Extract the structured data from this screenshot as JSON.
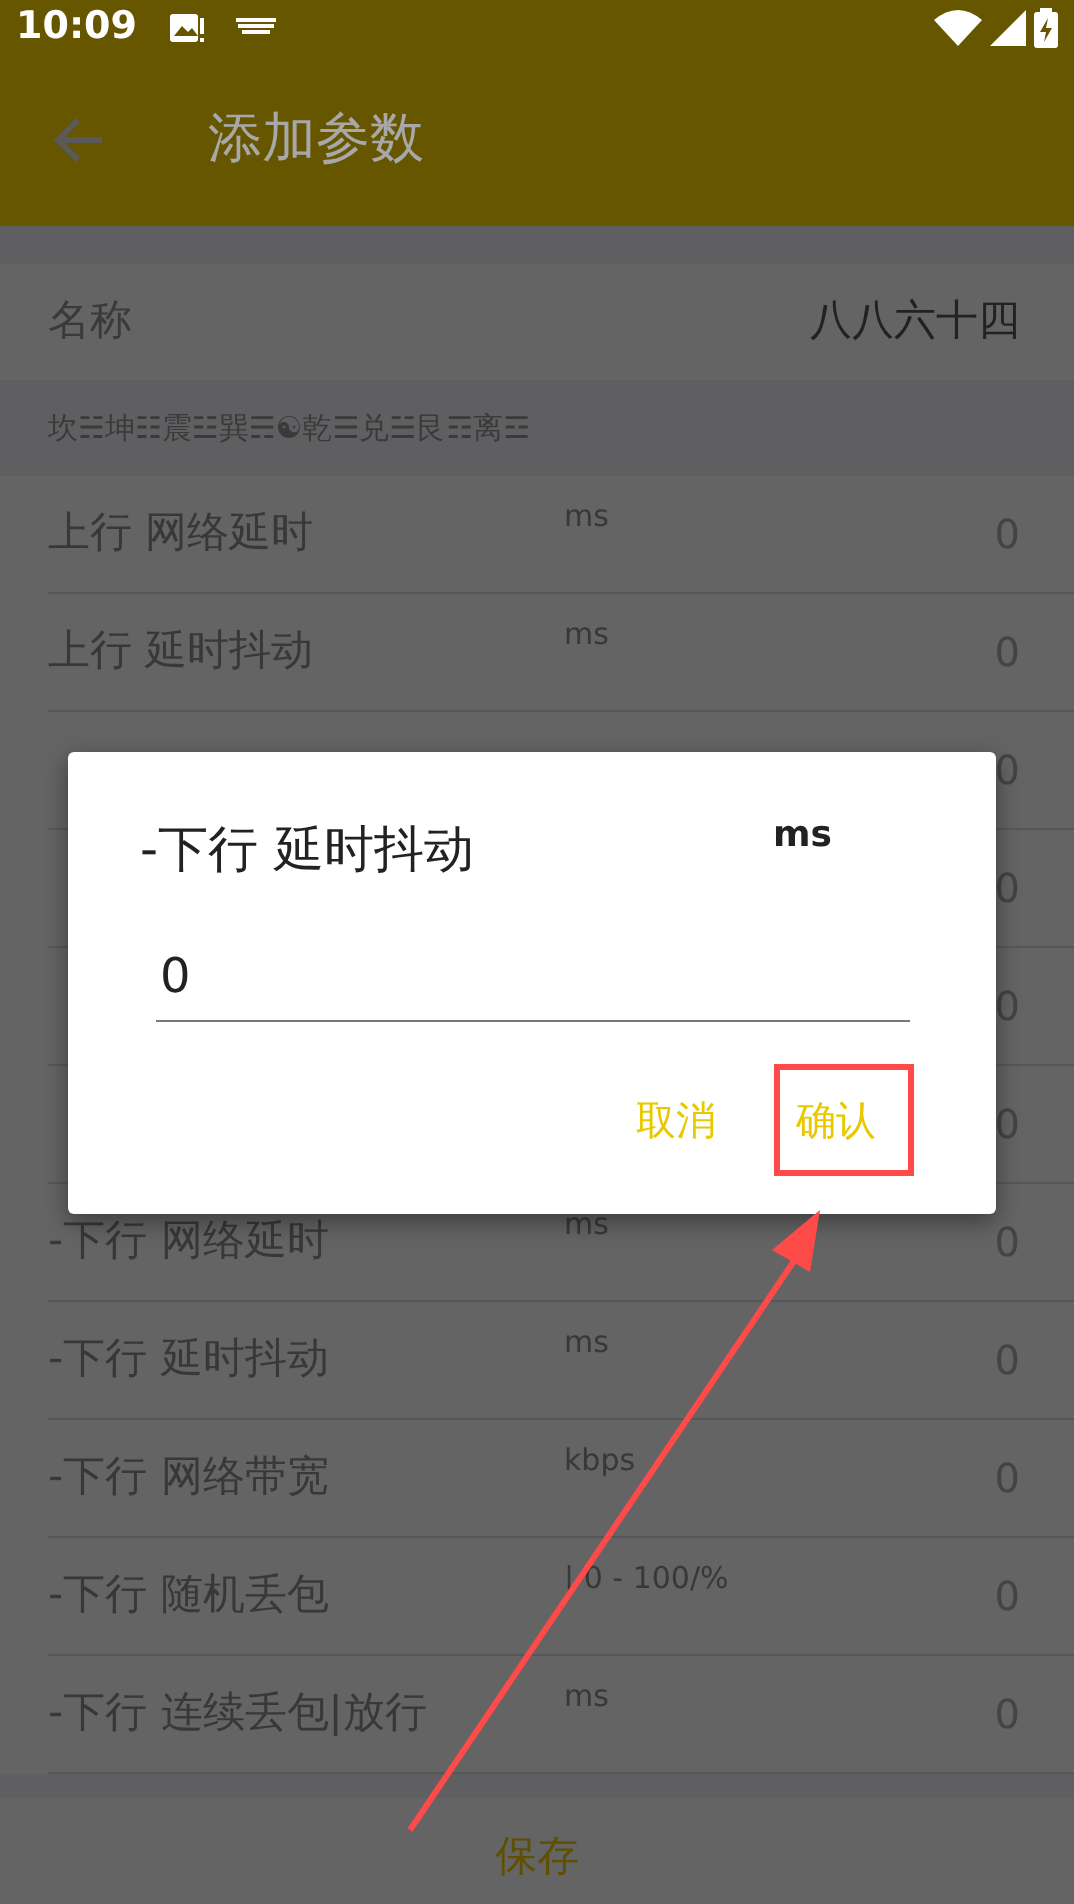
{
  "status_bar": {
    "time": "10:09"
  },
  "toolbar": {
    "title": "添加参数"
  },
  "name_field": {
    "label": "名称",
    "value": "八八六十四"
  },
  "section_note": "坎☵坤☷震☳巽☴☯乾☰兑☱艮☶离☲",
  "params": [
    {
      "label": "上行 网络延时",
      "unit": "ms",
      "value": "0"
    },
    {
      "label": "上行 延时抖动",
      "unit": "ms",
      "value": "0"
    },
    {
      "value": "0"
    },
    {
      "value": "0"
    },
    {
      "value": "0"
    },
    {
      "value": "0"
    },
    {
      "label": "-下行 网络延时",
      "unit": "ms",
      "value": "0"
    },
    {
      "label": "-下行 延时抖动",
      "unit": "ms",
      "value": "0"
    },
    {
      "label": "-下行 网络带宽",
      "unit": "kbps",
      "value": "0"
    },
    {
      "label": "-下行 随机丢包",
      "unit": "| 0 - 100/%",
      "value": "0"
    },
    {
      "label": "-下行 连续丢包|放行",
      "unit": "ms",
      "value": "0"
    }
  ],
  "dialog": {
    "title": "-下行 延时抖动",
    "unit": "ms",
    "value": "0",
    "buttons": [
      {
        "label": "取消",
        "highlighted": false
      },
      {
        "label": "确认",
        "highlighted": true
      }
    ]
  },
  "save_button": "保存"
}
